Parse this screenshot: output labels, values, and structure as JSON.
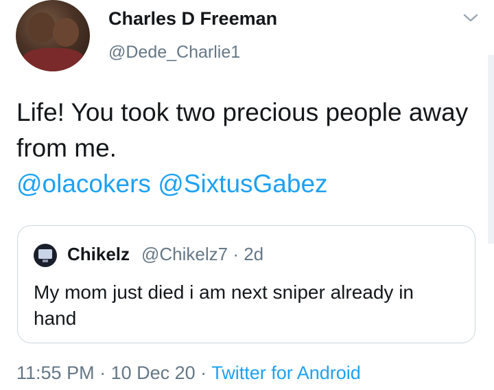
{
  "author": {
    "name": "Charles D Freeman",
    "handle": "@Dede_Charlie1"
  },
  "tweet": {
    "text": "Life! You took two precious people away from me.",
    "mention1": "@olacokers",
    "mention2": "@SixtusGabez"
  },
  "quoted": {
    "name": "Chikelz",
    "handle": "@Chikelz7 · 2d",
    "text": "My mom just died i am next sniper already in hand"
  },
  "meta": {
    "time": "11:55 PM",
    "date": "10 Dec 20",
    "source": "Twitter for Android",
    "sep": " · "
  },
  "colors": {
    "link": "#1da1f2",
    "secondary": "#657786",
    "border": "#ccd6dd"
  },
  "icons": {
    "menu": "chevron-down-icon"
  }
}
